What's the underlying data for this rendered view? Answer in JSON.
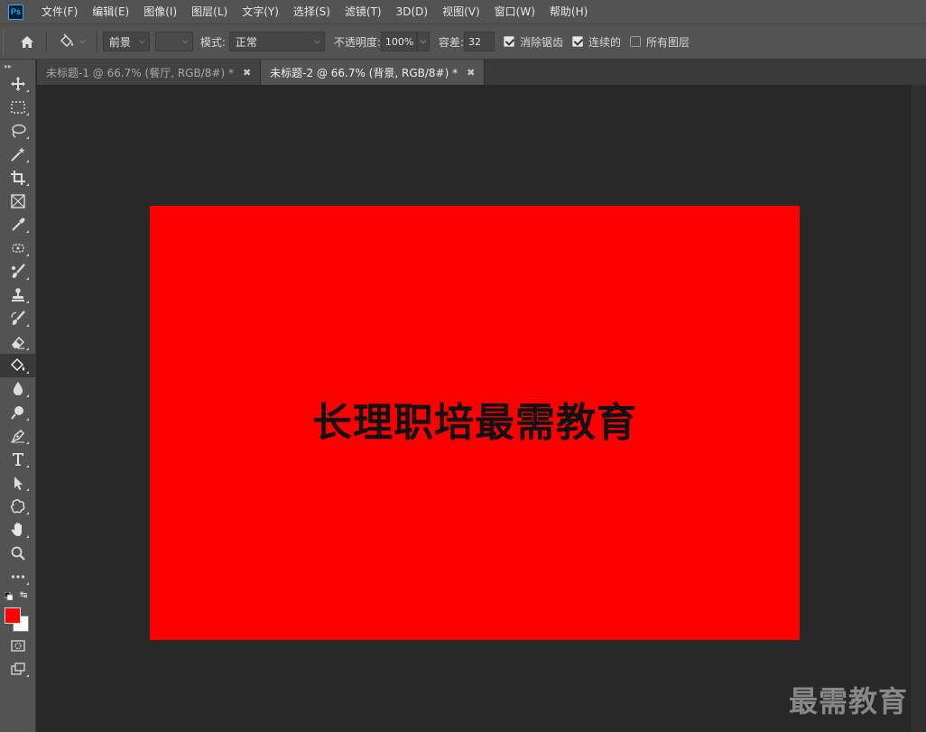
{
  "app": {
    "logo": "Ps",
    "menu": [
      "文件(F)",
      "编辑(E)",
      "图像(I)",
      "图层(L)",
      "文字(Y)",
      "选择(S)",
      "滤镜(T)",
      "3D(D)",
      "视图(V)",
      "窗口(W)",
      "帮助(H)"
    ]
  },
  "options": {
    "fill_source": "前景",
    "pattern": "",
    "mode_label": "模式:",
    "mode_value": "正常",
    "opacity_label": "不透明度:",
    "opacity_value": "100%",
    "tolerance_label": "容差:",
    "tolerance_value": "32",
    "antialias_label": "消除锯齿",
    "antialias_checked": true,
    "contiguous_label": "连续的",
    "contiguous_checked": true,
    "all_layers_label": "所有图层",
    "all_layers_checked": false
  },
  "tabs": [
    {
      "label": "未标题-1 @ 66.7% (餐厅, RGB/8#) *",
      "active": false
    },
    {
      "label": "未标题-2 @ 66.7% (背景, RGB/8#) *",
      "active": true
    }
  ],
  "document": {
    "text": "长理职培最需教育",
    "fill_color": "#fe0000"
  },
  "colors": {
    "foreground": "#fe0000",
    "background": "#ffffff"
  },
  "tools": [
    "move-icon",
    "marquee-icon",
    "lasso-icon",
    "magic-wand-icon",
    "crop-icon",
    "frame-icon",
    "eyedropper-icon",
    "healing-brush-icon",
    "brush-icon",
    "clone-stamp-icon",
    "history-brush-icon",
    "eraser-icon",
    "paint-bucket-icon",
    "blur-icon",
    "dodge-icon",
    "pen-icon",
    "type-icon",
    "path-selection-icon",
    "custom-shape-icon",
    "hand-icon",
    "zoom-icon",
    "more-tools-icon"
  ],
  "watermark": "最需教育"
}
